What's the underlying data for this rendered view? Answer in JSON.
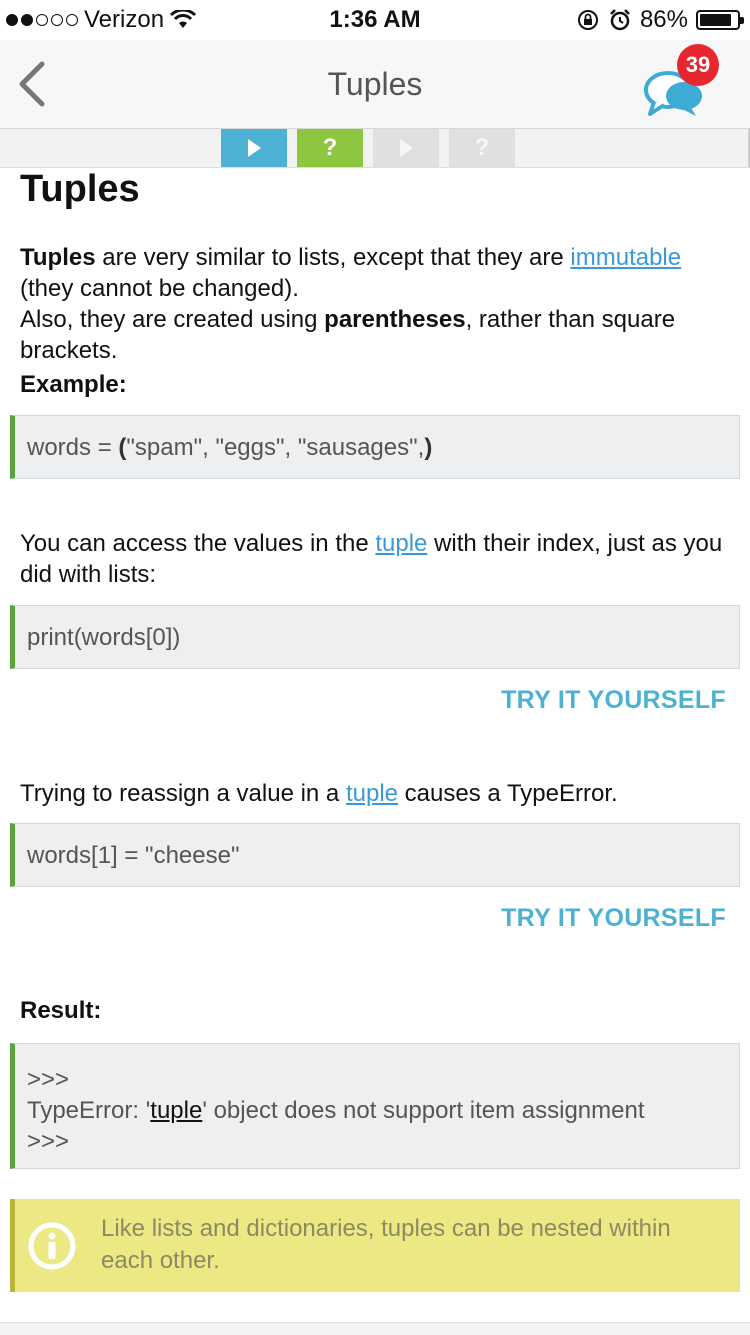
{
  "status_bar": {
    "carrier": "Verizon",
    "time": "1:36 AM",
    "battery": "86%",
    "battery_level": 0.86
  },
  "nav": {
    "title": "Tuples",
    "badge_count": "39"
  },
  "progress_steps": [
    {
      "icon": "play-icon",
      "state": "active"
    },
    {
      "icon": "question-icon",
      "state": "active"
    },
    {
      "icon": "play-icon",
      "state": "inactive"
    },
    {
      "icon": "question-icon",
      "state": "inactive"
    }
  ],
  "lesson": {
    "heading": "Tuples",
    "p1_bold": "Tuples",
    "p1_a": " are very similar to lists, except that they are ",
    "p1_link": "immutable",
    "p1_b": " (they cannot be changed).",
    "p2_a": "Also, they are created using ",
    "p2_bold": "parentheses",
    "p2_b": ", rather than square brackets.",
    "example_label": "Example:",
    "code1_a": "words = ",
    "code1_open": "(",
    "code1_mid": "\"spam\", \"eggs\", \"sausages\",",
    "code1_close": ")",
    "p3_a": "You can access the values in the ",
    "p3_link": "tuple",
    "p3_b": " with their index, just as you did with lists:",
    "code2": "print(words[0])",
    "try1": "TRY IT YOURSELF",
    "p4_a": "Trying to reassign a value in a ",
    "p4_link": "tuple",
    "p4_b": " causes a TypeError.",
    "code3": "words[1] = \"cheese\"",
    "try2": "TRY IT YOURSELF",
    "result_label": "Result:",
    "result_line1": ">>>",
    "result_line2_a": "TypeError: '",
    "result_line2_link": "tuple",
    "result_line2_b": "' object does not support item assignment",
    "result_line3": ">>>",
    "tip": "Like lists and dictionaries, tuples can be nested within each other."
  },
  "colors": {
    "accent_blue": "#4cb1d3",
    "accent_green": "#8dc63f",
    "badge_red": "#e8262f",
    "tip_yellow": "#ece985"
  }
}
